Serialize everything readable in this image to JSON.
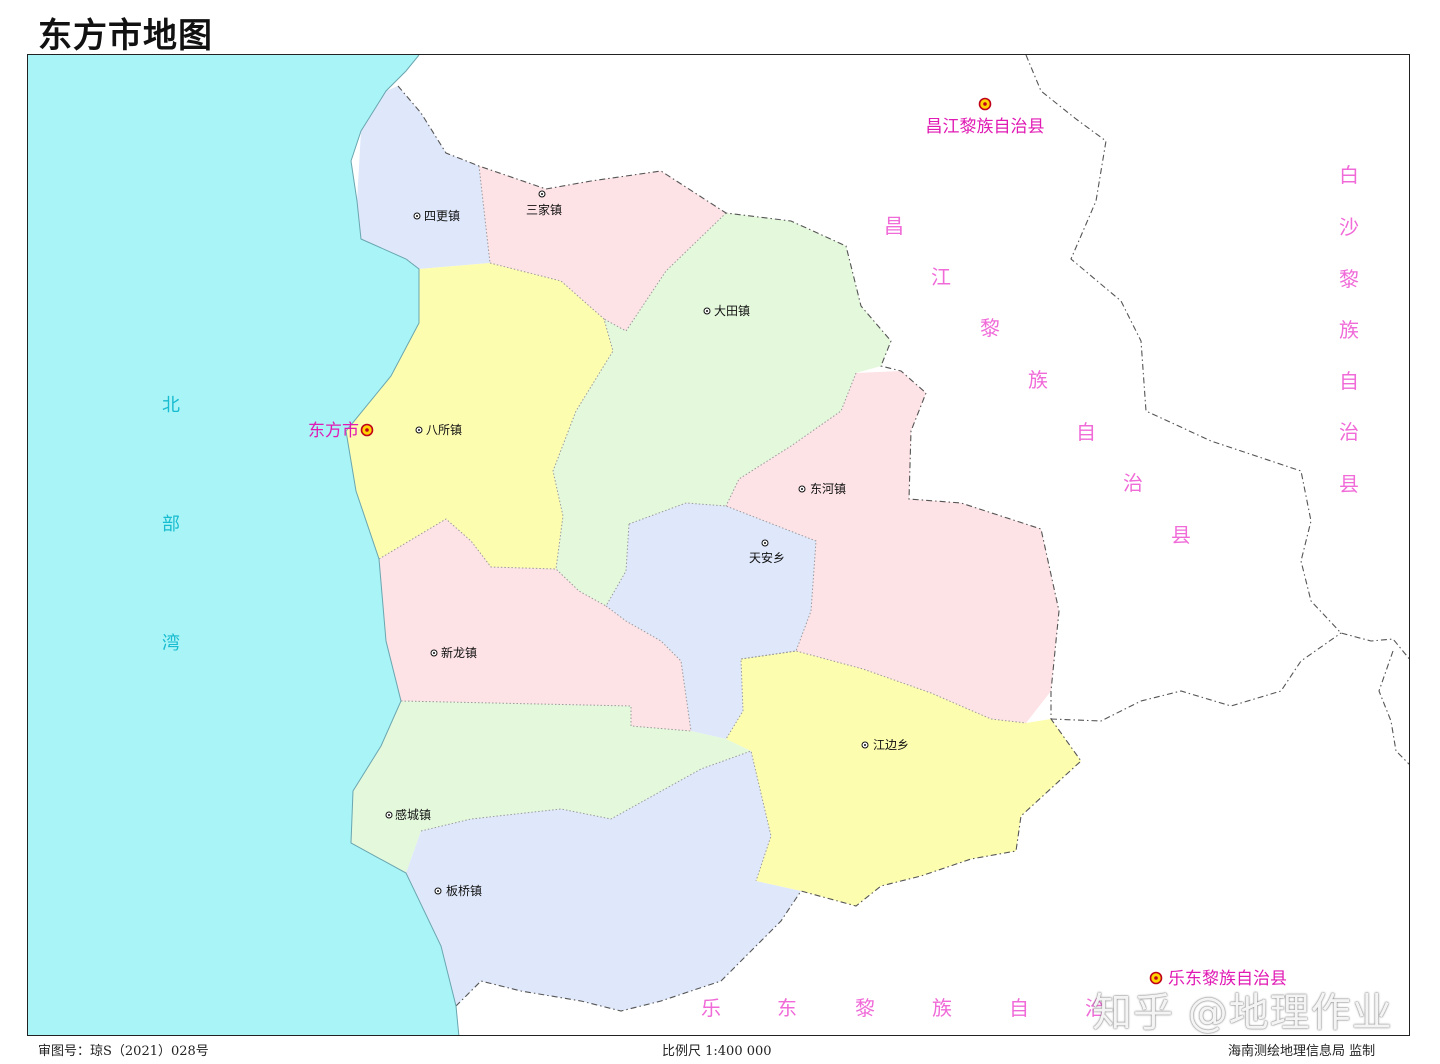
{
  "title": "东方市地图",
  "colors": {
    "sea": "#a8f4f6",
    "pink": "#fde2e6",
    "blue": "#dfe8fb",
    "yellow": "#fdfdb0",
    "green": "#e4f8dc",
    "magenta": "#e01ab4",
    "county_text": "#f06ad8",
    "sea_text": "#18bcd0"
  },
  "sea": {
    "name_chars": [
      "北",
      "部",
      "湾"
    ]
  },
  "city": {
    "name": "东方市",
    "symbol": "city-seat-icon"
  },
  "towns": [
    {
      "id": "sigeng",
      "name": "四更镇"
    },
    {
      "id": "sanjia",
      "name": "三家镇"
    },
    {
      "id": "datian",
      "name": "大田镇"
    },
    {
      "id": "basuo",
      "name": "八所镇"
    },
    {
      "id": "donghe",
      "name": "东河镇"
    },
    {
      "id": "tianan",
      "name": "天安乡"
    },
    {
      "id": "xinlong",
      "name": "新龙镇"
    },
    {
      "id": "jiangbian",
      "name": "江边乡"
    },
    {
      "id": "gancheng",
      "name": "感城镇"
    },
    {
      "id": "banqiao",
      "name": "板桥镇"
    }
  ],
  "neighbors": {
    "changjiang_seat": "昌江黎族自治县",
    "changjiang_chars": [
      "昌",
      "江",
      "黎",
      "族",
      "自",
      "治",
      "县"
    ],
    "baisha_chars": [
      "白",
      "沙",
      "黎",
      "族",
      "自",
      "治",
      "县"
    ],
    "ledong_seat": "乐东黎族自治县",
    "ledong_chars": [
      "乐",
      "东",
      "黎",
      "族",
      "自",
      "治"
    ]
  },
  "footer": {
    "approval": "审图号：琼S（2021）028号",
    "scale": "比例尺 1:400 000",
    "publisher": "海南测绘地理信息局 监制"
  },
  "watermark": "知乎 @地理作业"
}
